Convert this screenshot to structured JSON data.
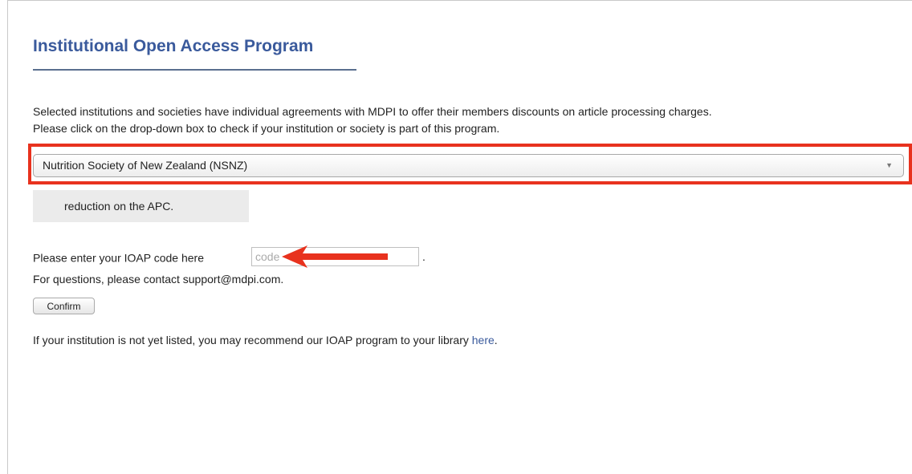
{
  "page": {
    "title": "Institutional Open Access Program",
    "intro_line1": "Selected institutions and societies have individual agreements with MDPI to offer their members discounts on article processing charges.",
    "intro_line2": "Please click on the drop-down box to check if your institution or society is part of this program."
  },
  "institution_select": {
    "selected": "Nutrition Society of New Zealand (NSNZ)",
    "highlight_color": "#e8321e"
  },
  "discount_note": "reduction on the APC.",
  "ioap": {
    "prompt": "Please enter your IOAP code here",
    "placeholder": "code",
    "value": "",
    "suffix": ".",
    "contact": "For questions, please contact support@mdpi.com."
  },
  "confirm_label": "Confirm",
  "footer": {
    "text": "If your institution is not yet listed, you may recommend our IOAP program to your library ",
    "link_label": "here",
    "suffix": "."
  },
  "colors": {
    "title": "#3a5a9c",
    "link": "#3a5a9c",
    "annotation_red": "#e8321e"
  }
}
